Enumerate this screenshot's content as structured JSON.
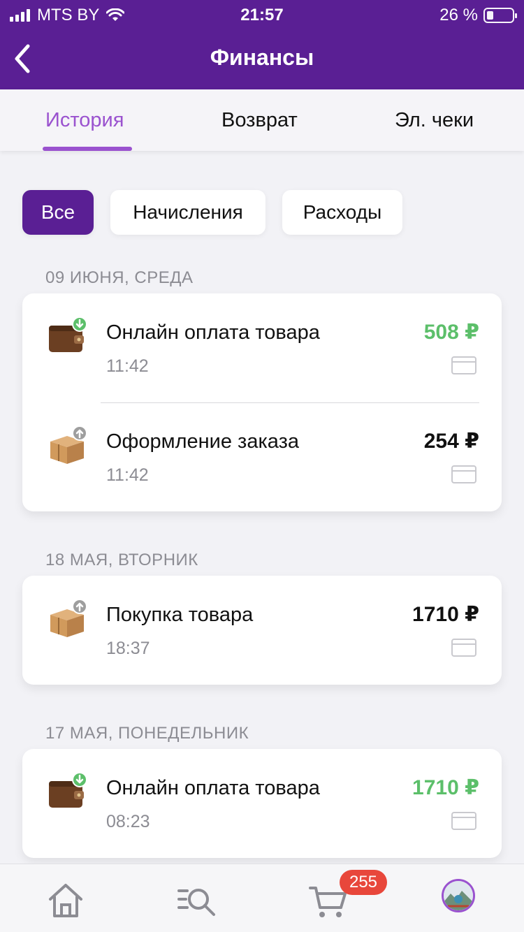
{
  "status": {
    "carrier": "MTS BY",
    "time": "21:57",
    "battery": "26 %"
  },
  "header": {
    "title": "Финансы"
  },
  "tabs": [
    {
      "label": "История",
      "active": true
    },
    {
      "label": "Возврат",
      "active": false
    },
    {
      "label": "Эл. чеки",
      "active": false
    }
  ],
  "filters": [
    {
      "label": "Все",
      "active": true
    },
    {
      "label": "Начисления",
      "active": false
    },
    {
      "label": "Расходы",
      "active": false
    }
  ],
  "groups": [
    {
      "date": "09 ИЮНЯ, СРЕДА",
      "items": [
        {
          "title": "Онлайн оплата товара",
          "time": "11:42",
          "amount": "508 ₽",
          "type": "income",
          "icon": "wallet-icon"
        },
        {
          "title": "Оформление заказа",
          "time": "11:42",
          "amount": "254 ₽",
          "type": "expense",
          "icon": "box-icon"
        }
      ]
    },
    {
      "date": "18 МАЯ, ВТОРНИК",
      "items": [
        {
          "title": "Покупка товара",
          "time": "18:37",
          "amount": "1710 ₽",
          "type": "expense",
          "icon": "box-icon"
        }
      ]
    },
    {
      "date": "17 МАЯ, ПОНЕДЕЛЬНИК",
      "items": [
        {
          "title": "Онлайн оплата товара",
          "time": "08:23",
          "amount": "1710 ₽",
          "type": "income",
          "icon": "wallet-icon"
        }
      ]
    }
  ],
  "nav": {
    "cart_badge": "255"
  },
  "colors": {
    "brand": "#5a1f94",
    "accent": "#9a52cf",
    "income": "#5cbf6a",
    "badge": "#e8473b"
  }
}
